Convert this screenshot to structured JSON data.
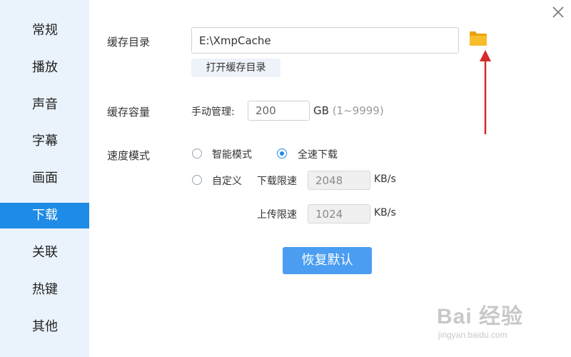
{
  "sidebar": {
    "items": [
      {
        "label": "常规"
      },
      {
        "label": "播放"
      },
      {
        "label": "声音"
      },
      {
        "label": "字幕"
      },
      {
        "label": "画面"
      },
      {
        "label": "下载",
        "active": true
      },
      {
        "label": "关联"
      },
      {
        "label": "热键"
      },
      {
        "label": "其他"
      }
    ]
  },
  "cache_dir": {
    "label": "缓存目录",
    "path_value": "E:\\XmpCache",
    "open_button": "打开缓存目录",
    "folder_icon": "folder-icon"
  },
  "cache_capacity": {
    "label": "缓存容量",
    "manual_label": "手动管理:",
    "value": "200",
    "unit": "GB",
    "range": "(1~9999)"
  },
  "speed_mode": {
    "label": "速度模式",
    "options": {
      "smart": "智能模式",
      "full": "全速下载",
      "custom": "自定义"
    },
    "selected": "full",
    "download_limit_label": "下载限速",
    "download_limit_value": "2048",
    "upload_limit_label": "上传限速",
    "upload_limit_value": "1024",
    "unit": "KB/s"
  },
  "restore_button": "恢复默认",
  "watermark": {
    "main": "Bai 经验",
    "sub": "jingyan.baidu.com"
  },
  "colors": {
    "accent": "#1e8be6",
    "primary_button": "#4a9df1",
    "sidebar_bg": "#eaf2fc",
    "folder": "#f5b21b",
    "annotation_arrow": "#d42a2a"
  }
}
